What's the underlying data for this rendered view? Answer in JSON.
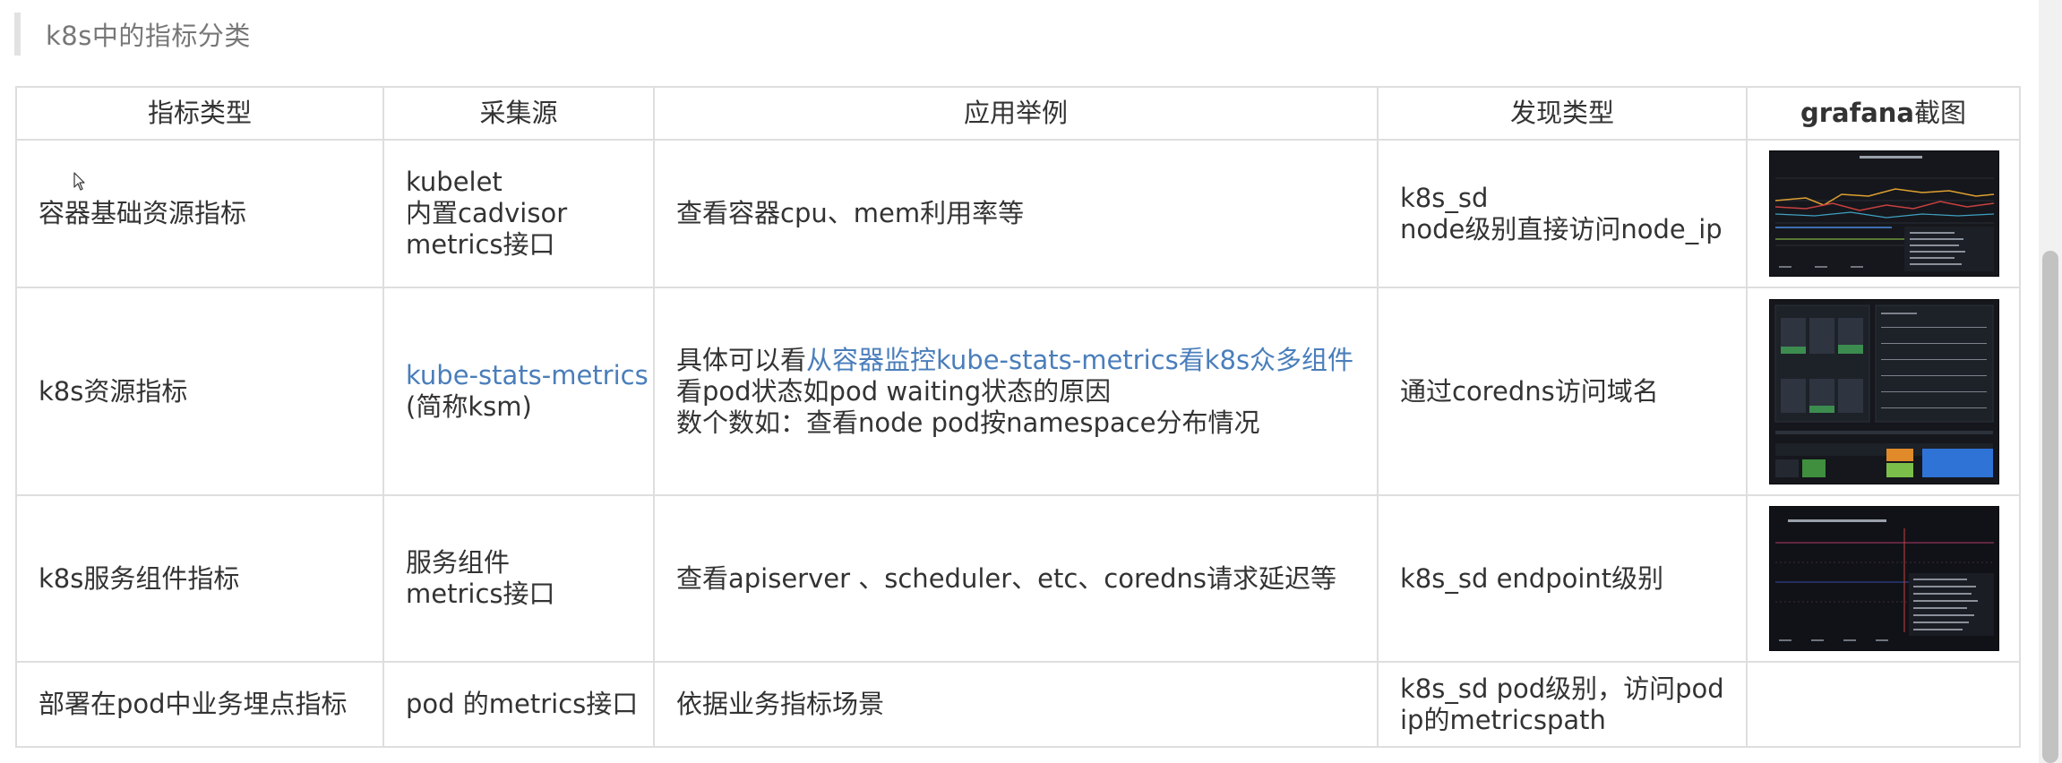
{
  "heading": "k8s中的指标分类",
  "table": {
    "headers": {
      "type": "指标类型",
      "source": "采集源",
      "example": "应用举例",
      "discovery": "发现类型",
      "grafana_bold": "grafana",
      "grafana_rest": "截图"
    },
    "rows": [
      {
        "type": "容器基础资源指标",
        "source_lines": [
          "kubelet",
          "内置cadvisor",
          "metrics接口"
        ],
        "example_lines": [
          "查看容器cpu、mem利用率等"
        ],
        "discovery_lines": [
          "k8s_sd",
          "node级别直接访问node_ip"
        ]
      },
      {
        "type": "k8s资源指标",
        "source_link": "kube-stats-metrics",
        "source_suffix": "(简称ksm)",
        "example_prefix": "具体可以看",
        "example_link": "从容器监控kube-stats-metrics看k8s众多组件",
        "example_lines": [
          "看pod状态如pod waiting状态的原因",
          "数个数如：查看node pod按namespace分布情况"
        ],
        "discovery_lines": [
          "通过coredns访问域名"
        ]
      },
      {
        "type": "k8s服务组件指标",
        "source_lines": [
          "服务组件",
          "metrics接口"
        ],
        "example_lines": [
          "查看apiserver 、scheduler、etc、coredns请求延迟等"
        ],
        "discovery_lines": [
          "k8s_sd endpoint级别"
        ]
      },
      {
        "type": "部署在pod中业务埋点指标",
        "source_lines": [
          "pod 的metrics接口"
        ],
        "example_lines": [
          "依据业务指标场景"
        ],
        "discovery_lines": [
          "k8s_sd pod级别，访问pod",
          "ip的metricspath"
        ]
      }
    ]
  },
  "colors": {
    "link": "#4a7ebb",
    "border": "#dedede",
    "heading": "#777777",
    "text": "#333333",
    "thumb_bg": "#15171c"
  },
  "icons": {
    "cursor": "mouse-pointer-icon"
  }
}
